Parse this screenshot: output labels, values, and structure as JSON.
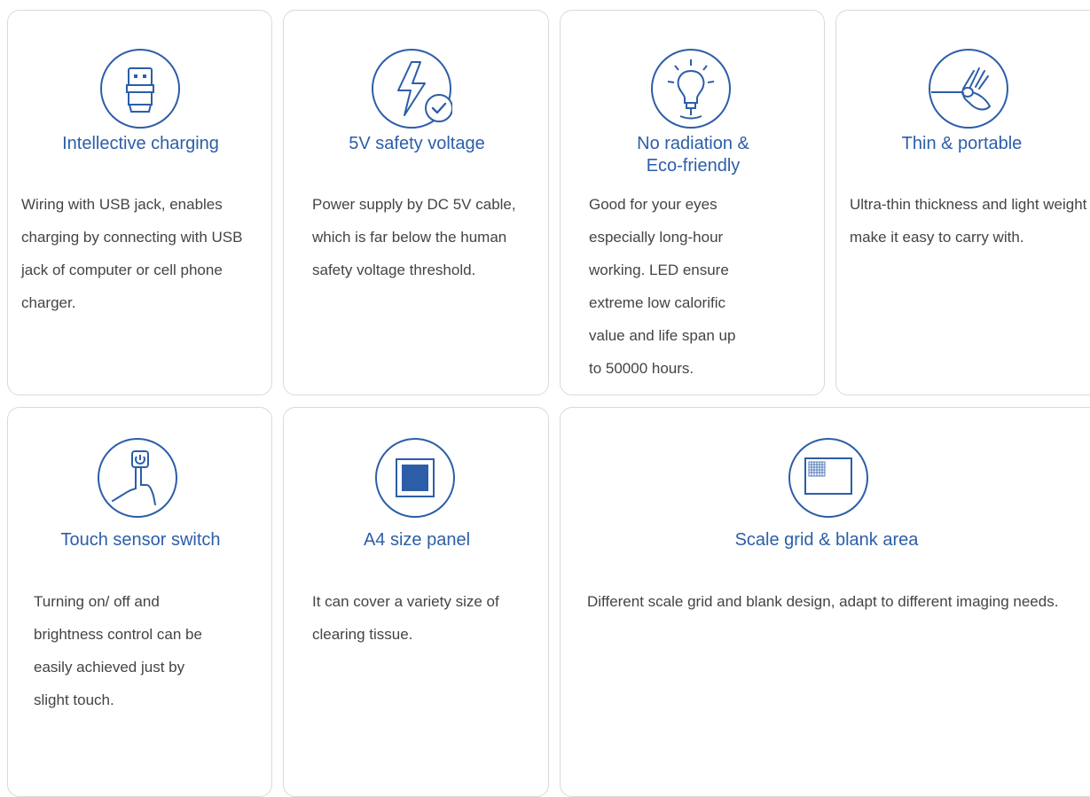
{
  "features": [
    {
      "title": "Intellective charging",
      "description": "Wiring with USB jack, enables charging by connecting with USB jack of computer or cell phone charger.",
      "icon": "usb-icon"
    },
    {
      "title": "5V safety voltage",
      "description": "Power supply by DC 5V cable, which is far below the human safety voltage threshold.",
      "icon": "lightning-check-icon"
    },
    {
      "title_line1": "No radiation &",
      "title_line2": "Eco-friendly",
      "description": "Good for your eyes especially long-hour working. LED ensure extreme low calorific value and life span up to 50000 hours.",
      "icon": "light-bulb-icon"
    },
    {
      "title": "Thin & portable",
      "description": "Ultra-thin thickness and light weight make it easy to carry with.",
      "icon": "ok-hand-icon"
    },
    {
      "title": "Touch sensor switch",
      "description": "Turning on/ off and brightness control can be easily achieved just by slight touch.",
      "icon": "touch-power-icon"
    },
    {
      "title": "A4 size panel",
      "description": "It can cover a variety size of clearing tissue.",
      "icon": "panel-square-icon"
    },
    {
      "title": "Scale grid & blank area",
      "description": "Different scale grid and blank design, adapt to different imaging needs.",
      "icon": "grid-panel-icon"
    }
  ],
  "colors": {
    "accent": "#2c5ea8",
    "text": "#444444",
    "border": "#d9d9d9"
  }
}
